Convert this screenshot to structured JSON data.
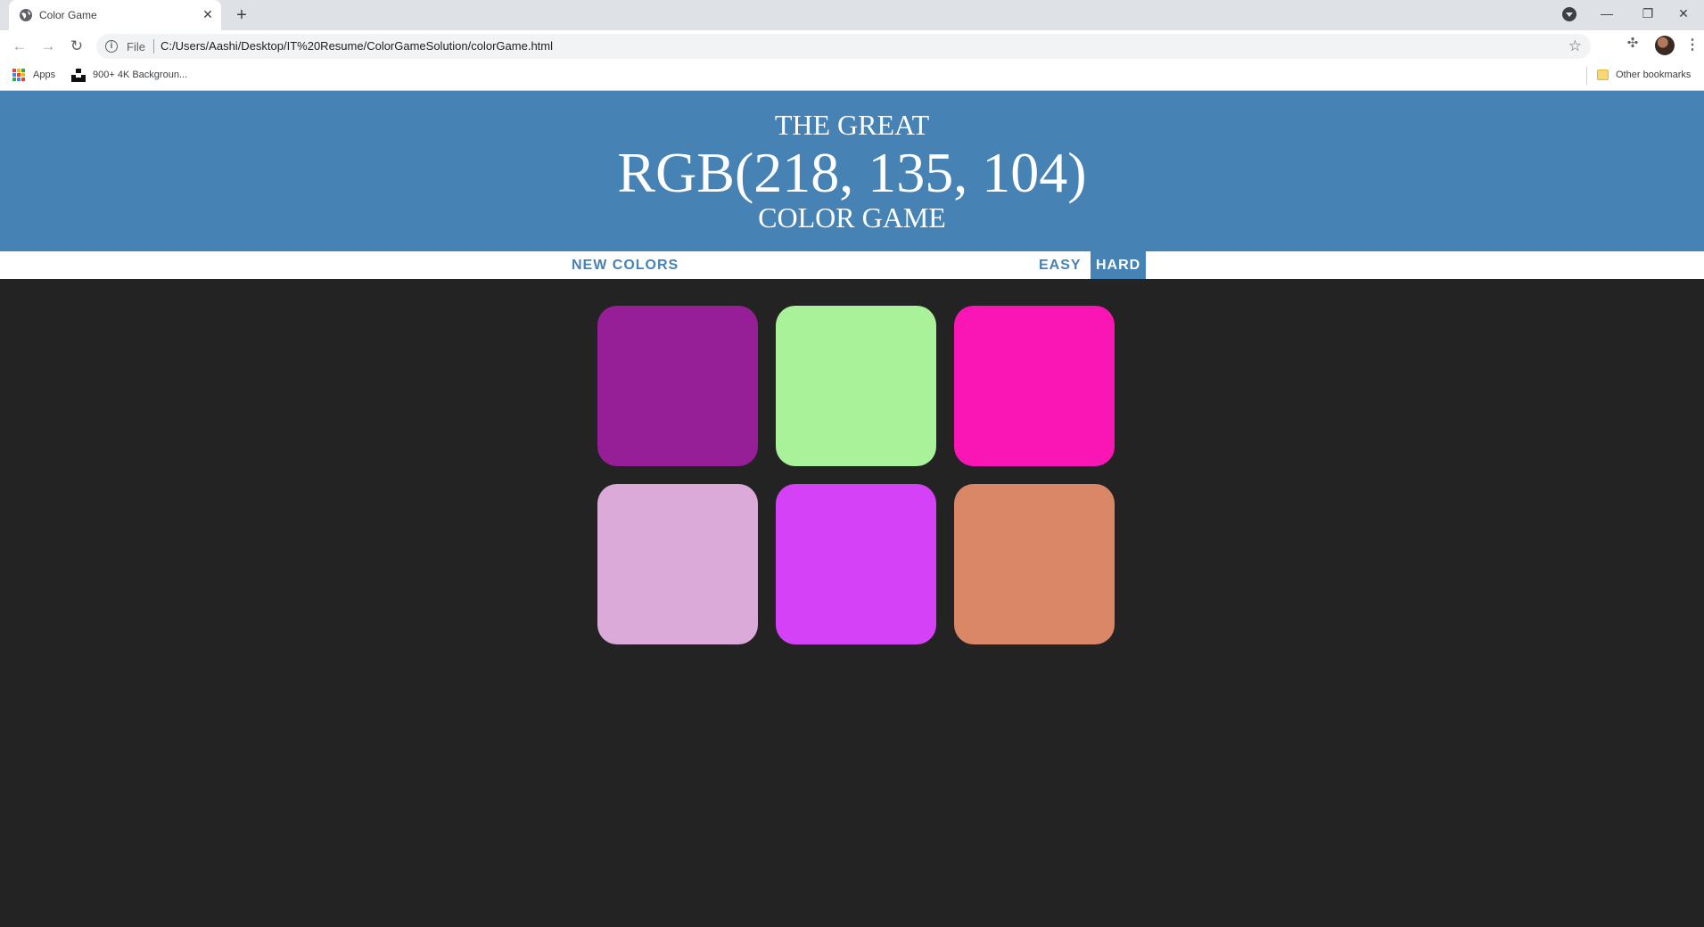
{
  "browser": {
    "tab_title": "Color Game",
    "tab_close": "✕",
    "new_tab": "+",
    "scheme_label": "File",
    "url": "C:/Users/Aashi/Desktop/IT%20Resume/ColorGameSolution/colorGame.html",
    "window_controls": {
      "minimize": "—",
      "restore": "❐",
      "close": "✕"
    },
    "nav": {
      "back": "←",
      "forward": "→",
      "reload": "↻"
    },
    "bookmarks": {
      "apps": "Apps",
      "item1": "900+ 4K Backgroun...",
      "other": "Other bookmarks"
    }
  },
  "header": {
    "line1": "THE GREAT",
    "rgb": "RGB(218, 135, 104)",
    "line3": "COLOR GAME"
  },
  "stripe": {
    "new_colors": "NEW COLORS",
    "easy": "EASY",
    "hard": "HARD",
    "selected_mode": "HARD"
  },
  "squares": [
    {
      "color": "#961e96"
    },
    {
      "color": "#aaf29a"
    },
    {
      "color": "#fa16b4"
    },
    {
      "color": "#dbaad8"
    },
    {
      "color": "#d541f6"
    },
    {
      "color": "#da8768"
    }
  ],
  "colors": {
    "header_bg": "#4682b4",
    "page_bg": "#232323",
    "stripe_bg": "#ffffff"
  }
}
